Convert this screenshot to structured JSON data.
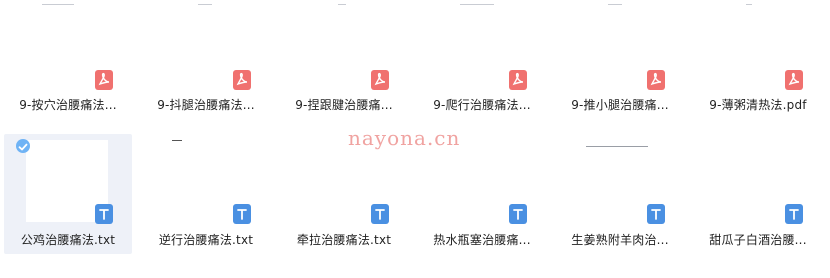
{
  "row1": [
    {
      "name": "9-按穴治腰痛法...",
      "type": "pdf"
    },
    {
      "name": "9-抖腿治腰痛法...",
      "type": "pdf"
    },
    {
      "name": "9-捏跟腱治腰痛...",
      "type": "pdf"
    },
    {
      "name": "9-爬行治腰痛法...",
      "type": "pdf"
    },
    {
      "name": "9-推小腿治腰痛...",
      "type": "pdf"
    },
    {
      "name": "9-薄粥清热法.pdf",
      "type": "pdf"
    }
  ],
  "row2": [
    {
      "name": "公鸡治腰痛法.txt",
      "type": "txt",
      "selected": true
    },
    {
      "name": "逆行治腰痛法.txt",
      "type": "txt"
    },
    {
      "name": "牵拉治腰痛法.txt",
      "type": "txt"
    },
    {
      "name": "热水瓶塞治腰痛...",
      "type": "txt"
    },
    {
      "name": "生姜熟附羊肉治...",
      "type": "txt"
    },
    {
      "name": "甜瓜子白酒治腰...",
      "type": "txt"
    }
  ],
  "watermark": "nayona.cn",
  "colors": {
    "pdf": "#f0716f",
    "txt": "#4a90e2",
    "selection": "#eef1f8",
    "check": "#6fb3f5"
  },
  "icons": {
    "pdf": "pdf-file-icon",
    "txt": "txt-file-icon",
    "check": "check-circle-icon"
  }
}
